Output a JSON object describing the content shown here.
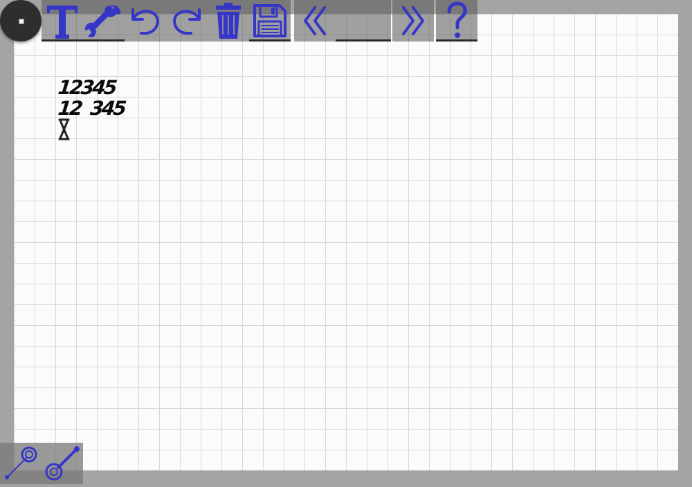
{
  "canvas": {
    "lines": [
      "12345",
      "12  345"
    ]
  },
  "toolbar": {
    "tools": [
      {
        "name": "text-tool",
        "icon": "text-T-icon"
      },
      {
        "name": "settings-tool",
        "icon": "wrench-icon"
      },
      {
        "name": "undo-button",
        "icon": "undo-arrow-icon"
      },
      {
        "name": "redo-button",
        "icon": "redo-arrow-icon"
      },
      {
        "name": "delete-button",
        "icon": "trash-can-icon"
      },
      {
        "name": "save-button",
        "icon": "floppy-disk-icon"
      },
      {
        "name": "previous-page-button",
        "icon": "double-chevron-left-icon"
      },
      {
        "name": "page-indicator",
        "icon": ""
      },
      {
        "name": "next-page-button",
        "icon": "double-chevron-right-icon"
      },
      {
        "name": "help-button",
        "icon": "question-mark-icon"
      }
    ]
  },
  "bottom_tools": [
    {
      "name": "pen-size-small",
      "icon": "pen-target-icon"
    },
    {
      "name": "pen-size-large",
      "icon": "pen-target-icon"
    }
  ],
  "colors": {
    "icon": "#3535c8",
    "ink": "#0b0b0b",
    "grid": "#d8d8d8",
    "paper": "#fbfbfb",
    "background": "#a4a4a4"
  }
}
